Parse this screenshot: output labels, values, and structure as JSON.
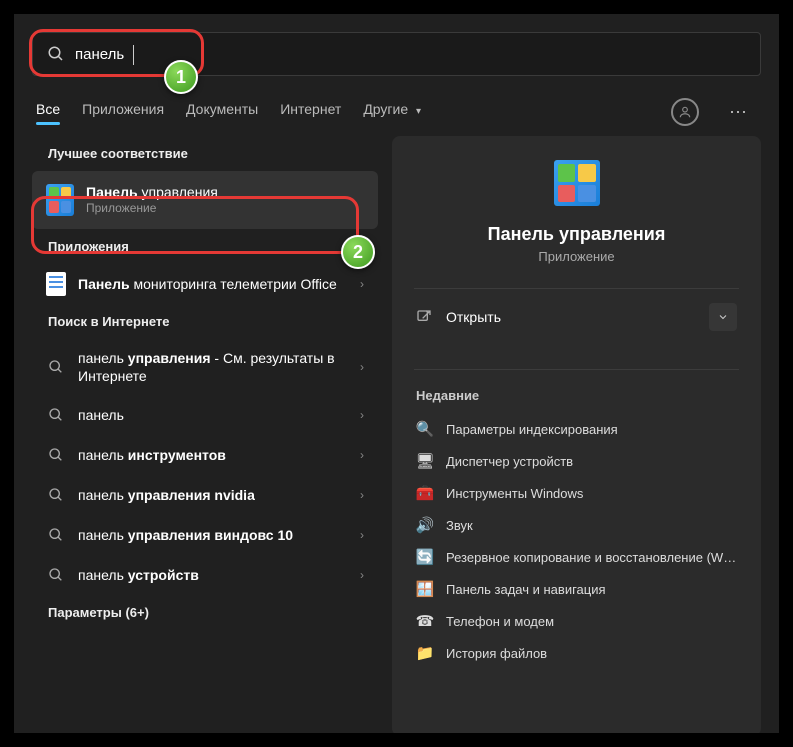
{
  "search": {
    "value": "панель"
  },
  "tabs": {
    "items": [
      {
        "label": "Все",
        "active": true
      },
      {
        "label": "Приложения"
      },
      {
        "label": "Документы"
      },
      {
        "label": "Интернет"
      },
      {
        "label": "Другие",
        "dropdown": true
      }
    ]
  },
  "left": {
    "best_match_header": "Лучшее соответствие",
    "best_match": {
      "title_bold": "Панель",
      "title_rest": " управления",
      "subtitle": "Приложение"
    },
    "apps_header": "Приложения",
    "apps": [
      {
        "title_bold": "Панель",
        "title_rest": " мониторинга телеметрии Office"
      }
    ],
    "web_header": "Поиск в Интернете",
    "web": [
      {
        "prefix": "панель ",
        "bold": "управления",
        "suffix": " - См. результаты в Интернете"
      },
      {
        "prefix": "панель",
        "bold": "",
        "suffix": ""
      },
      {
        "prefix": "панель ",
        "bold": "инструментов",
        "suffix": ""
      },
      {
        "prefix": "панель ",
        "bold": "управления nvidia",
        "suffix": ""
      },
      {
        "prefix": "панель ",
        "bold": "управления виндовс 10",
        "suffix": ""
      },
      {
        "prefix": "панель ",
        "bold": "устройств",
        "suffix": ""
      }
    ],
    "settings_header": "Параметры (6+)"
  },
  "preview": {
    "title": "Панель управления",
    "subtitle": "Приложение",
    "open_label": "Открыть",
    "recent_header": "Недавние",
    "recent": [
      {
        "icon": "🔍",
        "label": "Параметры индексирования"
      },
      {
        "icon": "🖥",
        "label": "Диспетчер устройств"
      },
      {
        "icon": "🧰",
        "label": "Инструменты Windows"
      },
      {
        "icon": "🔊",
        "label": "Звук"
      },
      {
        "icon": "🔄",
        "label": "Резервное копирование и восстановление (Wind..."
      },
      {
        "icon": "🪟",
        "label": "Панель задач и навигация"
      },
      {
        "icon": "☎",
        "label": "Телефон и модем"
      },
      {
        "icon": "📁",
        "label": "История файлов"
      }
    ]
  },
  "annotations": {
    "badge1": "1",
    "badge2": "2"
  }
}
